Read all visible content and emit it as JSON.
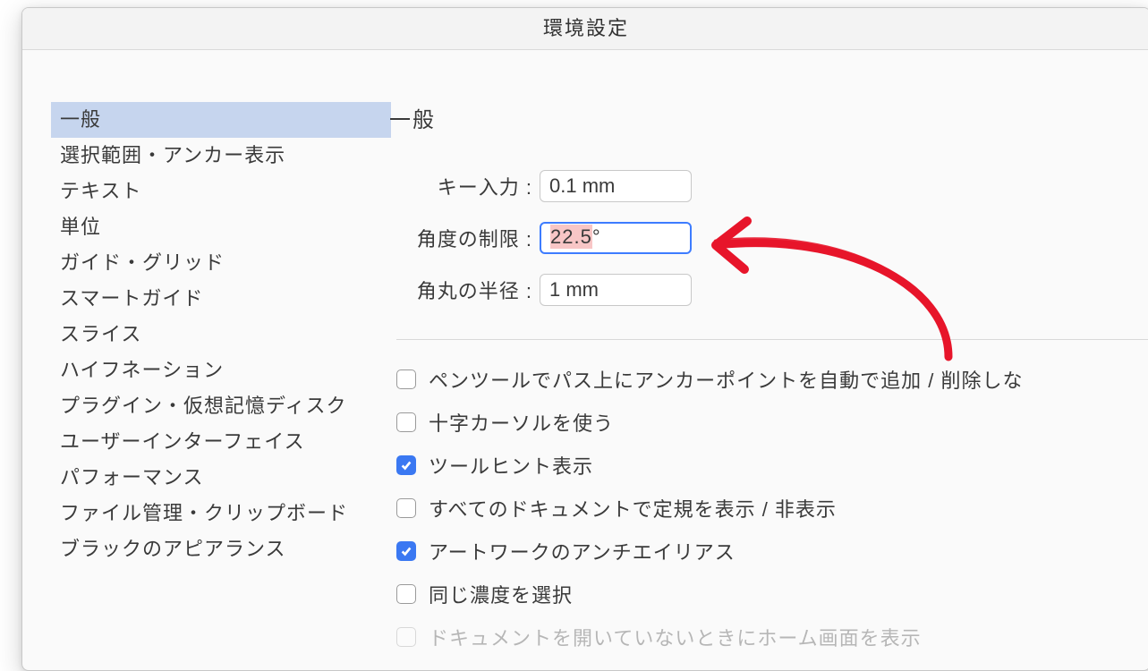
{
  "title": "環境設定",
  "sidebar": {
    "items": [
      {
        "label": "一般",
        "selected": true
      },
      {
        "label": "選択範囲・アンカー表示",
        "selected": false
      },
      {
        "label": "テキスト",
        "selected": false
      },
      {
        "label": "単位",
        "selected": false
      },
      {
        "label": "ガイド・グリッド",
        "selected": false
      },
      {
        "label": "スマートガイド",
        "selected": false
      },
      {
        "label": "スライス",
        "selected": false
      },
      {
        "label": "ハイフネーション",
        "selected": false
      },
      {
        "label": "プラグイン・仮想記憶ディスク",
        "selected": false
      },
      {
        "label": "ユーザーインターフェイス",
        "selected": false
      },
      {
        "label": "パフォーマンス",
        "selected": false
      },
      {
        "label": "ファイル管理・クリップボード",
        "selected": false
      },
      {
        "label": "ブラックのアピアランス",
        "selected": false
      }
    ]
  },
  "content": {
    "section_title": "一般",
    "fields": {
      "key_input": {
        "label": "キー入力 :",
        "value": "0.1 mm"
      },
      "angle_limit": {
        "label": "角度の制限 :",
        "value": "22.5°",
        "focused": true,
        "selected_text": "22.5"
      },
      "corner_radius": {
        "label": "角丸の半径 :",
        "value": "1 mm"
      }
    },
    "checks": [
      {
        "label": "ペンツールでパス上にアンカーポイントを自動で追加 / 削除しな",
        "checked": false
      },
      {
        "label": "十字カーソルを使う",
        "checked": false
      },
      {
        "label": "ツールヒント表示",
        "checked": true
      },
      {
        "label": "すべてのドキュメントで定規を表示 / 非表示",
        "checked": false
      },
      {
        "label": "アートワークのアンチエイリアス",
        "checked": true
      },
      {
        "label": "同じ濃度を選択",
        "checked": false
      },
      {
        "label": "ドキュメントを開いていないときにホーム画面を表示",
        "checked": false,
        "faded": true
      }
    ]
  },
  "annotation": {
    "arrow_color": "#e7152a"
  }
}
